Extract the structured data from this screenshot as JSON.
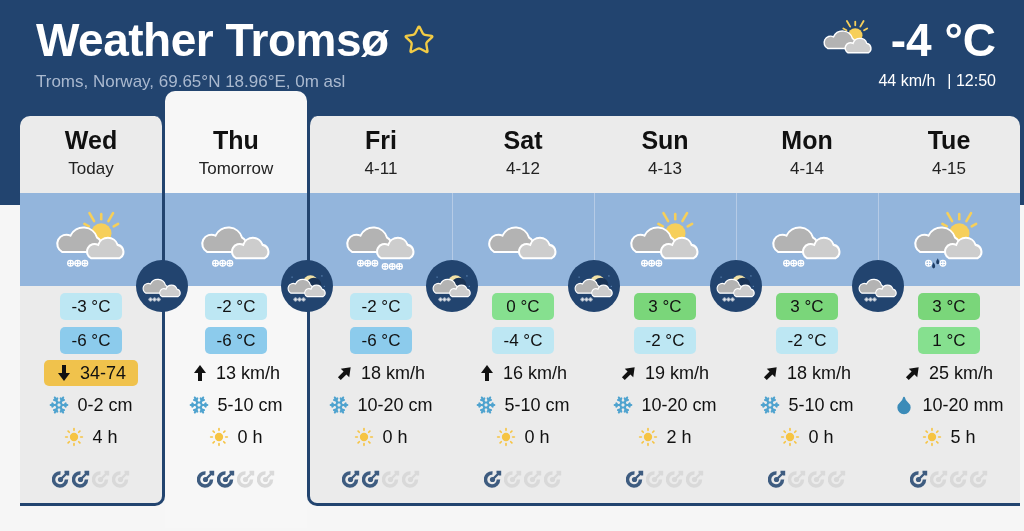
{
  "header": {
    "title": "Weather Tromsø",
    "favorite": false,
    "subtitle": "Troms, Norway, 69.65°N 18.96°E, 0m asl"
  },
  "current": {
    "icon": {
      "kind": "partly_cloudy"
    },
    "temperature": "-4 °C",
    "wind": "44 km/h",
    "time": "| 12:50"
  },
  "days": [
    {
      "name": "Wed",
      "sub": "Today",
      "selected": false,
      "icon": {
        "kind": "partly_cloudy_snow"
      },
      "night": {
        "kind": "cloudy_snow"
      },
      "high": {
        "text": "-3 °C",
        "color": "#bde7f3"
      },
      "low": {
        "text": "-6 °C",
        "color": "#8ccbec"
      },
      "wind": {
        "kind": "down",
        "text": "34-74",
        "warning": true
      },
      "precip": {
        "kind": "snow",
        "text": "0-2 cm"
      },
      "sunshine": "4 h",
      "reliability": [
        {
          "filled": true
        },
        {
          "filled": true
        },
        {
          "filled": false
        },
        {
          "filled": false
        }
      ]
    },
    {
      "name": "Thu",
      "sub": "Tomorrow",
      "selected": true,
      "icon": {
        "kind": "cloudy_snow"
      },
      "night": {
        "kind": "moon_snow"
      },
      "high": {
        "text": "-2 °C",
        "color": "#bde7f3"
      },
      "low": {
        "text": "-6 °C",
        "color": "#8ccbec"
      },
      "wind": {
        "kind": "up",
        "text": "13 km/h",
        "warning": false
      },
      "precip": {
        "kind": "snow",
        "text": "5-10 cm"
      },
      "sunshine": "0 h",
      "reliability": [
        {
          "filled": true
        },
        {
          "filled": true
        },
        {
          "filled": false
        },
        {
          "filled": false
        }
      ]
    },
    {
      "name": "Fri",
      "sub": "4-11",
      "selected": false,
      "icon": {
        "kind": "cloudy_heavysnow"
      },
      "night": {
        "kind": "moon_snow"
      },
      "high": {
        "text": "-2 °C",
        "color": "#bde7f3"
      },
      "low": {
        "text": "-6 °C",
        "color": "#8ccbec"
      },
      "wind": {
        "kind": "upright",
        "text": "18 km/h",
        "warning": false
      },
      "precip": {
        "kind": "snow",
        "text": "10-20 cm"
      },
      "sunshine": "0 h",
      "reliability": [
        {
          "filled": true
        },
        {
          "filled": true
        },
        {
          "filled": false
        },
        {
          "filled": false
        }
      ]
    },
    {
      "name": "Sat",
      "sub": "4-12",
      "selected": false,
      "icon": {
        "kind": "cloudy"
      },
      "night": {
        "kind": "moon_snow"
      },
      "high": {
        "text": "0 °C",
        "color": "#86e08f"
      },
      "low": {
        "text": "-4 °C",
        "color": "#bde7f3"
      },
      "wind": {
        "kind": "up",
        "text": "16 km/h",
        "warning": false
      },
      "precip": {
        "kind": "snow",
        "text": "5-10 cm"
      },
      "sunshine": "0 h",
      "reliability": [
        {
          "filled": true
        },
        {
          "filled": false
        },
        {
          "filled": false
        },
        {
          "filled": false
        }
      ]
    },
    {
      "name": "Sun",
      "sub": "4-13",
      "selected": false,
      "icon": {
        "kind": "partly_cloudy_snow"
      },
      "night": {
        "kind": "moon_snow"
      },
      "high": {
        "text": "3 °C",
        "color": "#7ad67a"
      },
      "low": {
        "text": "-2 °C",
        "color": "#bde7f3"
      },
      "wind": {
        "kind": "upright",
        "text": "19 km/h",
        "warning": false
      },
      "precip": {
        "kind": "snow",
        "text": "10-20 cm"
      },
      "sunshine": "2 h",
      "reliability": [
        {
          "filled": true
        },
        {
          "filled": false
        },
        {
          "filled": false
        },
        {
          "filled": false
        }
      ]
    },
    {
      "name": "Mon",
      "sub": "4-14",
      "selected": false,
      "icon": {
        "kind": "cloudy_snow"
      },
      "night": {
        "kind": "cloudy_snow"
      },
      "high": {
        "text": "3 °C",
        "color": "#7ad67a"
      },
      "low": {
        "text": "-2 °C",
        "color": "#bde7f3"
      },
      "wind": {
        "kind": "upright",
        "text": "18 km/h",
        "warning": false
      },
      "precip": {
        "kind": "snow",
        "text": "5-10 cm"
      },
      "sunshine": "0 h",
      "reliability": [
        {
          "filled": true
        },
        {
          "filled": false
        },
        {
          "filled": false
        },
        {
          "filled": false
        }
      ]
    },
    {
      "name": "Tue",
      "sub": "4-15",
      "selected": false,
      "icon": {
        "kind": "partly_cloudy_sleet"
      },
      "high": {
        "text": "3 °C",
        "color": "#7ad67a"
      },
      "low": {
        "text": "1 °C",
        "color": "#86e08f"
      },
      "wind": {
        "kind": "upright",
        "text": "25 km/h",
        "warning": false
      },
      "precip": {
        "kind": "rain",
        "text": "10-20 mm"
      },
      "sunshine": "5 h",
      "reliability": [
        {
          "filled": true
        },
        {
          "filled": false
        },
        {
          "filled": false
        },
        {
          "filled": false
        }
      ]
    }
  ]
}
